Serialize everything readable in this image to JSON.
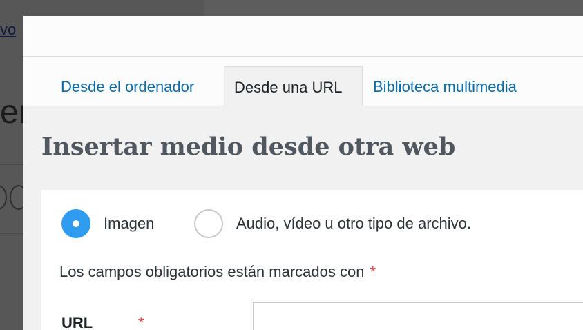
{
  "background": {
    "link_text": "vo",
    "heading_text": "er"
  },
  "tabs": [
    {
      "label": "Desde el ordenador"
    },
    {
      "label": "Desde una URL"
    },
    {
      "label": "Biblioteca multimedia"
    }
  ],
  "active_tab": "Desde una URL",
  "title": "Insertar medio desde otra web",
  "media_type": {
    "options": [
      {
        "label": "Imagen",
        "checked": true
      },
      {
        "label": "Audio, vídeo u otro tipo de archivo.",
        "checked": false
      }
    ]
  },
  "required_note": {
    "text": "Los campos obligatorios están marcados con",
    "marker": "*"
  },
  "url_field": {
    "label": "URL",
    "required_marker": "*",
    "value": ""
  },
  "colors": {
    "accent": "#2f9cf0",
    "link": "#0a6aa8",
    "required": "#d63638"
  }
}
